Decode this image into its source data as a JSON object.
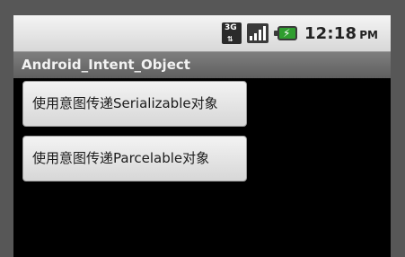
{
  "status_bar": {
    "network_label": "3G",
    "time": "12:18",
    "ampm": "PM",
    "icons": [
      "3g-network-icon",
      "signal-strength-icon",
      "battery-charging-icon"
    ]
  },
  "app": {
    "title": "Android_Intent_Object"
  },
  "buttons": {
    "serializable_label": "使用意图传递Serializable对象",
    "parcelable_label": "使用意图传递Parcelable对象"
  },
  "colors": {
    "title_bar": "#6e6e6e",
    "screen_background": "#000000",
    "battery_green": "#2f9d2f"
  }
}
